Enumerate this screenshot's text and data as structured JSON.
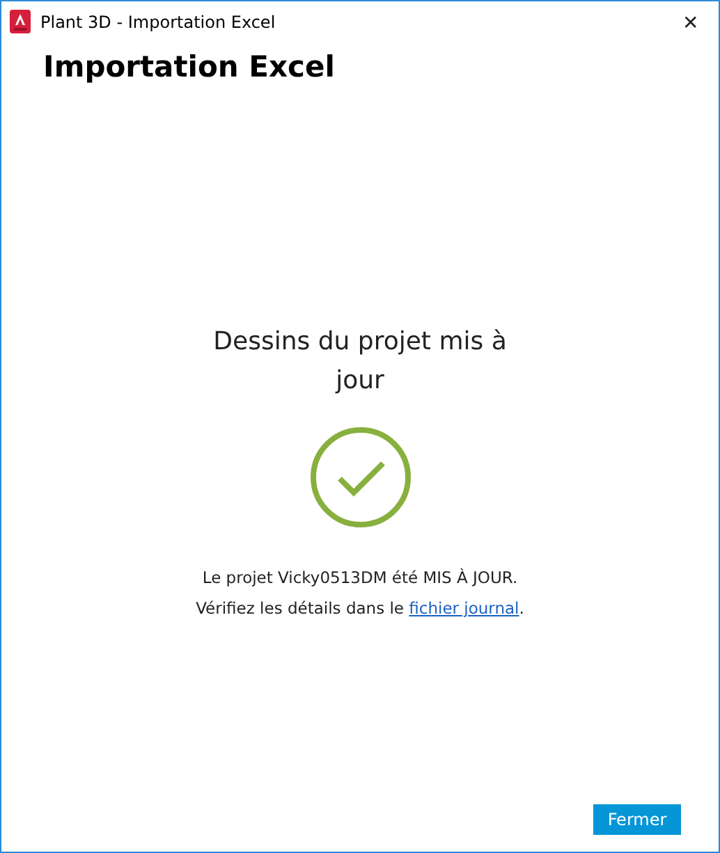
{
  "window": {
    "title": "Plant 3D - Importation Excel",
    "close": "✕"
  },
  "heading": "Importation Excel",
  "result": {
    "title": "Dessins du projet mis à jour",
    "succeeded": true,
    "message": "Le projet Vicky0513DM été MIS À JOUR.",
    "details_prefix": "Vérifiez les détails dans le ",
    "details_link": "fichier journal",
    "details_suffix": "."
  },
  "buttons": [
    {
      "label": "Fermer"
    }
  ]
}
